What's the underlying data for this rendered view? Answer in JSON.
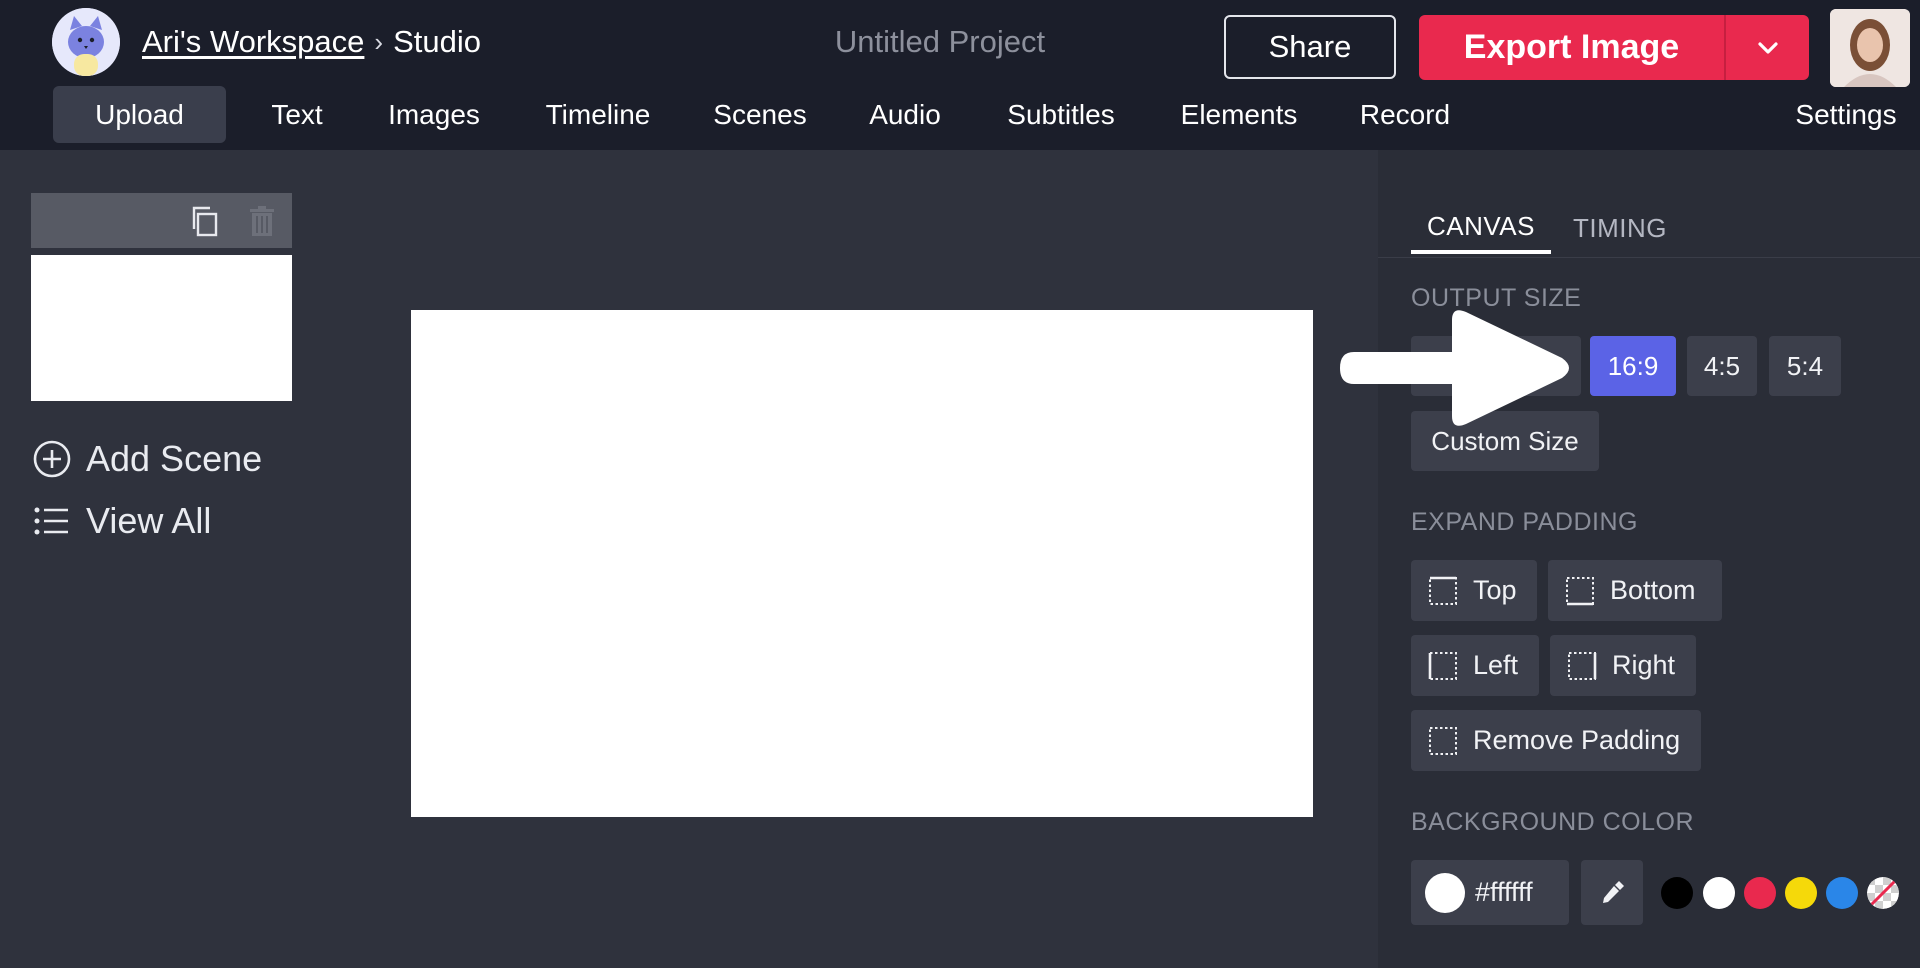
{
  "header": {
    "workspace": "Ari's Workspace",
    "separator": "›",
    "section": "Studio",
    "project_title": "Untitled Project",
    "share_label": "Share",
    "export_label": "Export Image"
  },
  "nav": {
    "items": [
      "Upload",
      "Text",
      "Images",
      "Timeline",
      "Scenes",
      "Audio",
      "Subtitles",
      "Elements",
      "Record"
    ],
    "settings_label": "Settings",
    "active": "Upload"
  },
  "scenes": {
    "add_label": "Add Scene",
    "view_all_label": "View All"
  },
  "panel": {
    "tabs": [
      "CANVAS",
      "TIMING"
    ],
    "active_tab": "CANVAS",
    "output_size": {
      "title": "OUTPUT SIZE",
      "options": [
        "16:9",
        "4:5",
        "5:4"
      ],
      "selected": "16:9",
      "custom_label": "Custom Size"
    },
    "padding": {
      "title": "EXPAND PADDING",
      "top": "Top",
      "bottom": "Bottom",
      "left": "Left",
      "right": "Right",
      "remove": "Remove Padding"
    },
    "background": {
      "title": "BACKGROUND COLOR",
      "hex": "#ffffff",
      "swatches": [
        "#000000",
        "#ffffff",
        "#e9294e",
        "#f5d90a",
        "#2a86e8",
        "transparent"
      ]
    }
  },
  "colors": {
    "accent": "#5b63e6",
    "export": "#e9294e",
    "header_bg": "#1b1e2a",
    "workspace_bg": "#2f323d",
    "panel_bg": "#2a2d37"
  },
  "icons": {
    "logo": "cat-logo-icon",
    "duplicate": "duplicate-icon",
    "delete": "trash-icon",
    "add": "plus-circle-icon",
    "list": "list-icon",
    "caret": "chevron-down-icon",
    "eyedropper": "eyedropper-icon",
    "overlay": "arrow-right-icon"
  }
}
